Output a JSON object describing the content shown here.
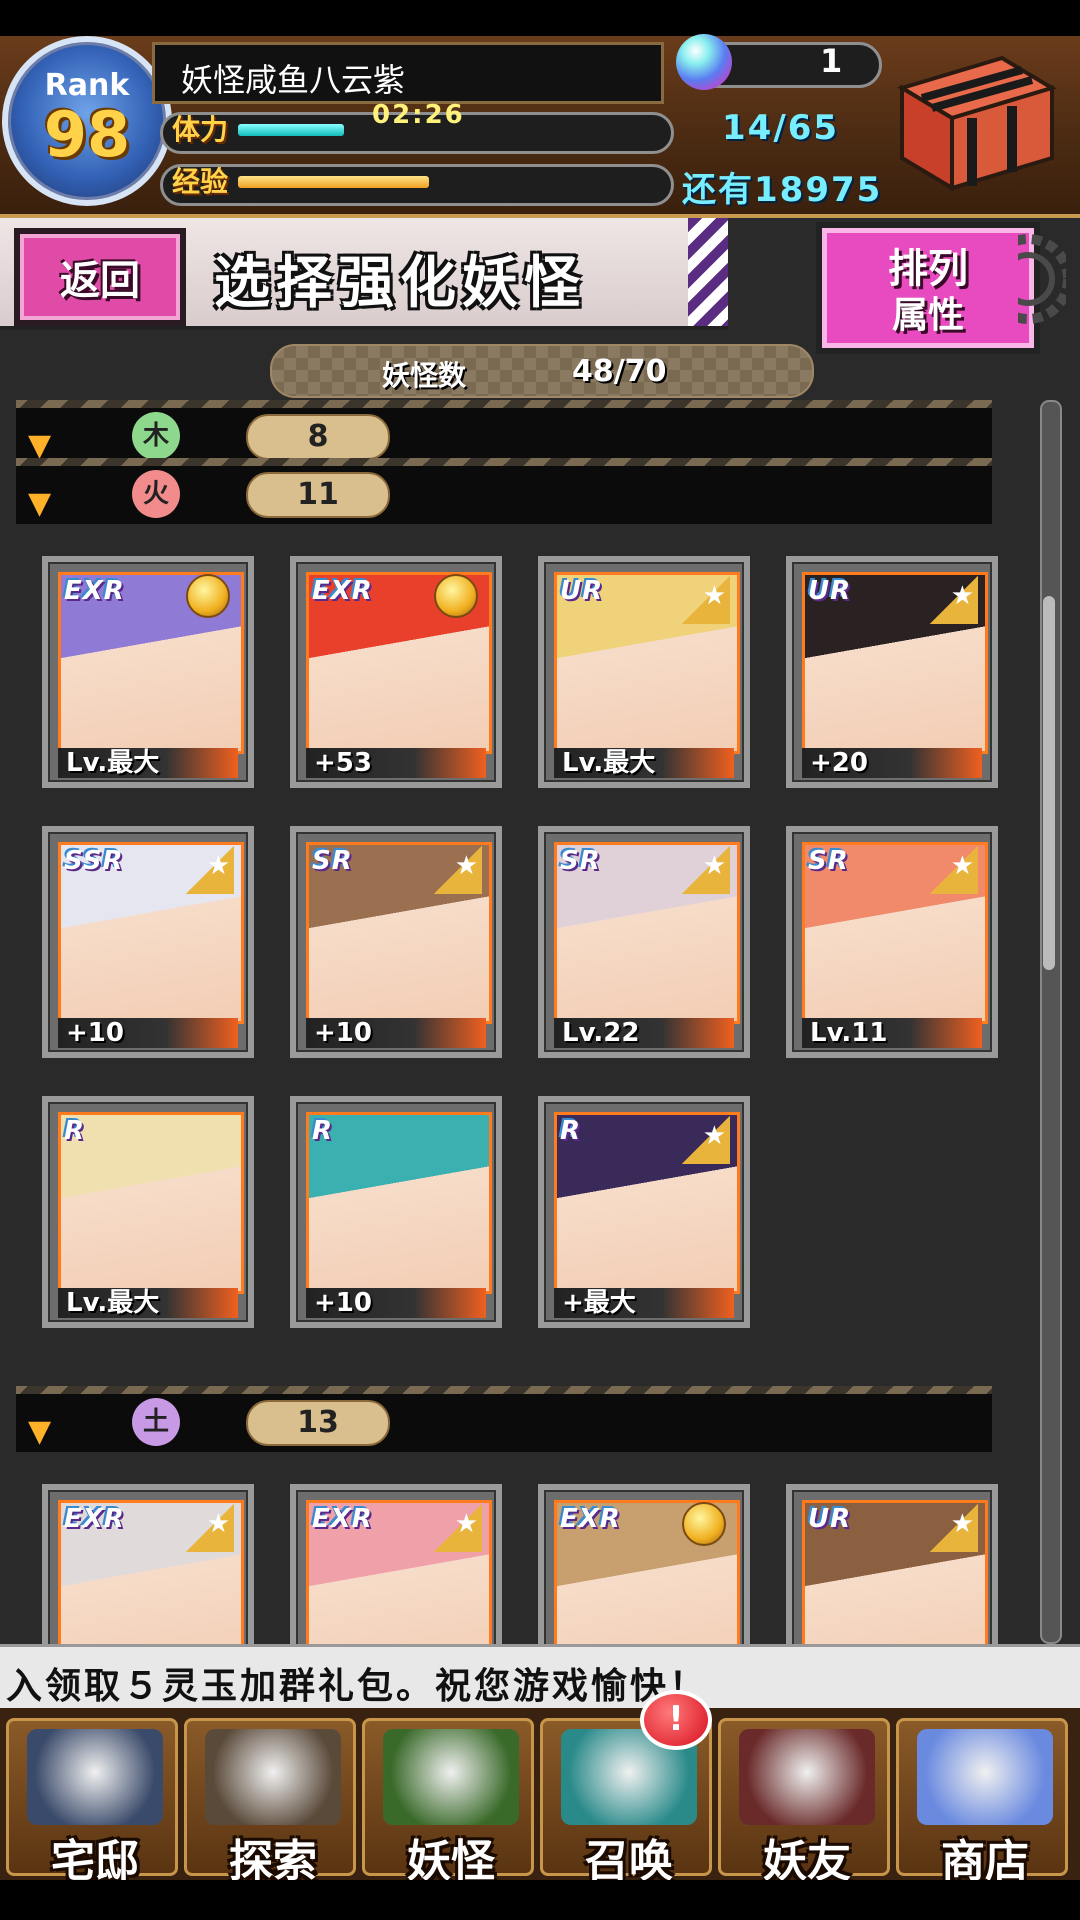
{
  "player": {
    "rank_label": "Rank",
    "rank": "98",
    "name": "妖怪咸鱼八云紫",
    "stamina_label": "体力",
    "stamina_timer": "02:26",
    "stamina_fill": 0.25,
    "exp_label": "经验",
    "exp_fill": 0.45,
    "gems": "1",
    "stamina_count": "14/65",
    "exp_remaining": "还有18975"
  },
  "header": {
    "back": "返回",
    "title": "选择强化妖怪",
    "sort_line1": "排列",
    "sort_line2": "属性"
  },
  "count": {
    "label": "妖怪数",
    "value": "48/70"
  },
  "groups": [
    {
      "icon": "木",
      "color": "#4caf50",
      "count": "8"
    },
    {
      "icon": "火",
      "color": "#e84a4a",
      "count": "11"
    },
    {
      "icon": "土",
      "color": "#b06ad8",
      "count": "13"
    }
  ],
  "cards": [
    {
      "rarity": "EXR",
      "mark": "medal",
      "level": "Lv.最大",
      "hair": "#8f7ad6"
    },
    {
      "rarity": "EXR",
      "mark": "medal",
      "level": "+53",
      "hair": "#e8402a"
    },
    {
      "rarity": "UR",
      "mark": "star",
      "level": "Lv.最大",
      "hair": "#f0d27a"
    },
    {
      "rarity": "UR",
      "mark": "star",
      "level": "+20",
      "hair": "#2a2222"
    },
    {
      "rarity": "SSR",
      "mark": "star",
      "level": "+10",
      "hair": "#e6e6f0"
    },
    {
      "rarity": "SR",
      "mark": "star",
      "level": "+10",
      "hair": "#9a7050"
    },
    {
      "rarity": "SR",
      "mark": "star",
      "level": "Lv.22",
      "hair": "#e0d0d8"
    },
    {
      "rarity": "SR",
      "mark": "star",
      "level": "Lv.11",
      "hair": "#f08a6a"
    },
    {
      "rarity": "R",
      "mark": "none",
      "level": "Lv.最大",
      "hair": "#f0e0b0"
    },
    {
      "rarity": "R",
      "mark": "none",
      "level": "+10",
      "hair": "#3ab0b0"
    },
    {
      "rarity": "R",
      "mark": "star",
      "level": "+最大",
      "hair": "#3a2a5a"
    },
    {
      "rarity": "EXR",
      "mark": "star",
      "level": "",
      "hair": "#e0dada"
    },
    {
      "rarity": "EXR",
      "mark": "star",
      "level": "",
      "hair": "#f0a0a8"
    },
    {
      "rarity": "EXR",
      "mark": "medal",
      "level": "",
      "hair": "#c8a070"
    },
    {
      "rarity": "UR",
      "mark": "star",
      "level": "",
      "hair": "#8a6040"
    }
  ],
  "notice": "入领取５灵玉加群礼包。祝您游戏愉快！",
  "nav": [
    {
      "label": "宅邸",
      "icon": "house-icon"
    },
    {
      "label": "探索",
      "icon": "magnifier-map-icon"
    },
    {
      "label": "妖怪",
      "icon": "scroll-icon"
    },
    {
      "label": "召唤",
      "icon": "pentagram-icon"
    },
    {
      "label": "妖友",
      "icon": "friend-icon"
    },
    {
      "label": "商店",
      "icon": "crystal-orb-icon"
    }
  ],
  "alert": "!"
}
